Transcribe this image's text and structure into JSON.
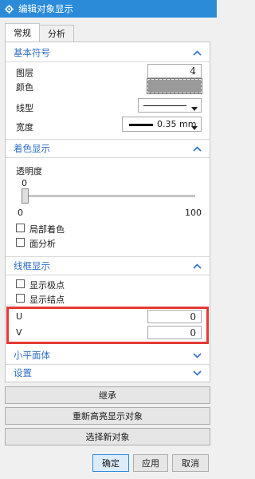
{
  "window": {
    "title": "编辑对象显示"
  },
  "tabs": [
    {
      "label": "常规"
    },
    {
      "label": "分析"
    }
  ],
  "basic_symbol": {
    "title": "基本符号",
    "layer_label": "图层",
    "layer_value": "4",
    "color_label": "颜色",
    "linetype_label": "线型",
    "width_label": "宽度",
    "width_value": "0.35 mm"
  },
  "shading": {
    "title": "着色显示",
    "transparency_label": "透明度",
    "slider_value": "0",
    "slider_min": "0",
    "slider_max": "100",
    "transparency_level": 0,
    "local_shading_label": "局部着色",
    "face_analysis_label": "面分析"
  },
  "wireframe": {
    "title": "线框显示",
    "show_poles_label": "显示极点",
    "show_knots_label": "显示结点",
    "u_label": "U",
    "u_value": "0",
    "v_label": "V",
    "v_value": "0"
  },
  "facet_body": {
    "title": "小平面体"
  },
  "settings": {
    "title": "设置"
  },
  "actions": {
    "inherit": "继承",
    "rehighlight": "重新高亮显示对象",
    "select_new": "选择新对象"
  },
  "footer": {
    "ok": "确定",
    "apply": "应用",
    "cancel": "取消"
  },
  "colors": {
    "title_bar": "#2b8bd9",
    "section_title": "#2e6fc4",
    "highlight_box": "#e53935"
  },
  "icons": {
    "app": "settings-icon",
    "expanded": "chevron-up-icon",
    "collapsed": "chevron-down-icon"
  }
}
